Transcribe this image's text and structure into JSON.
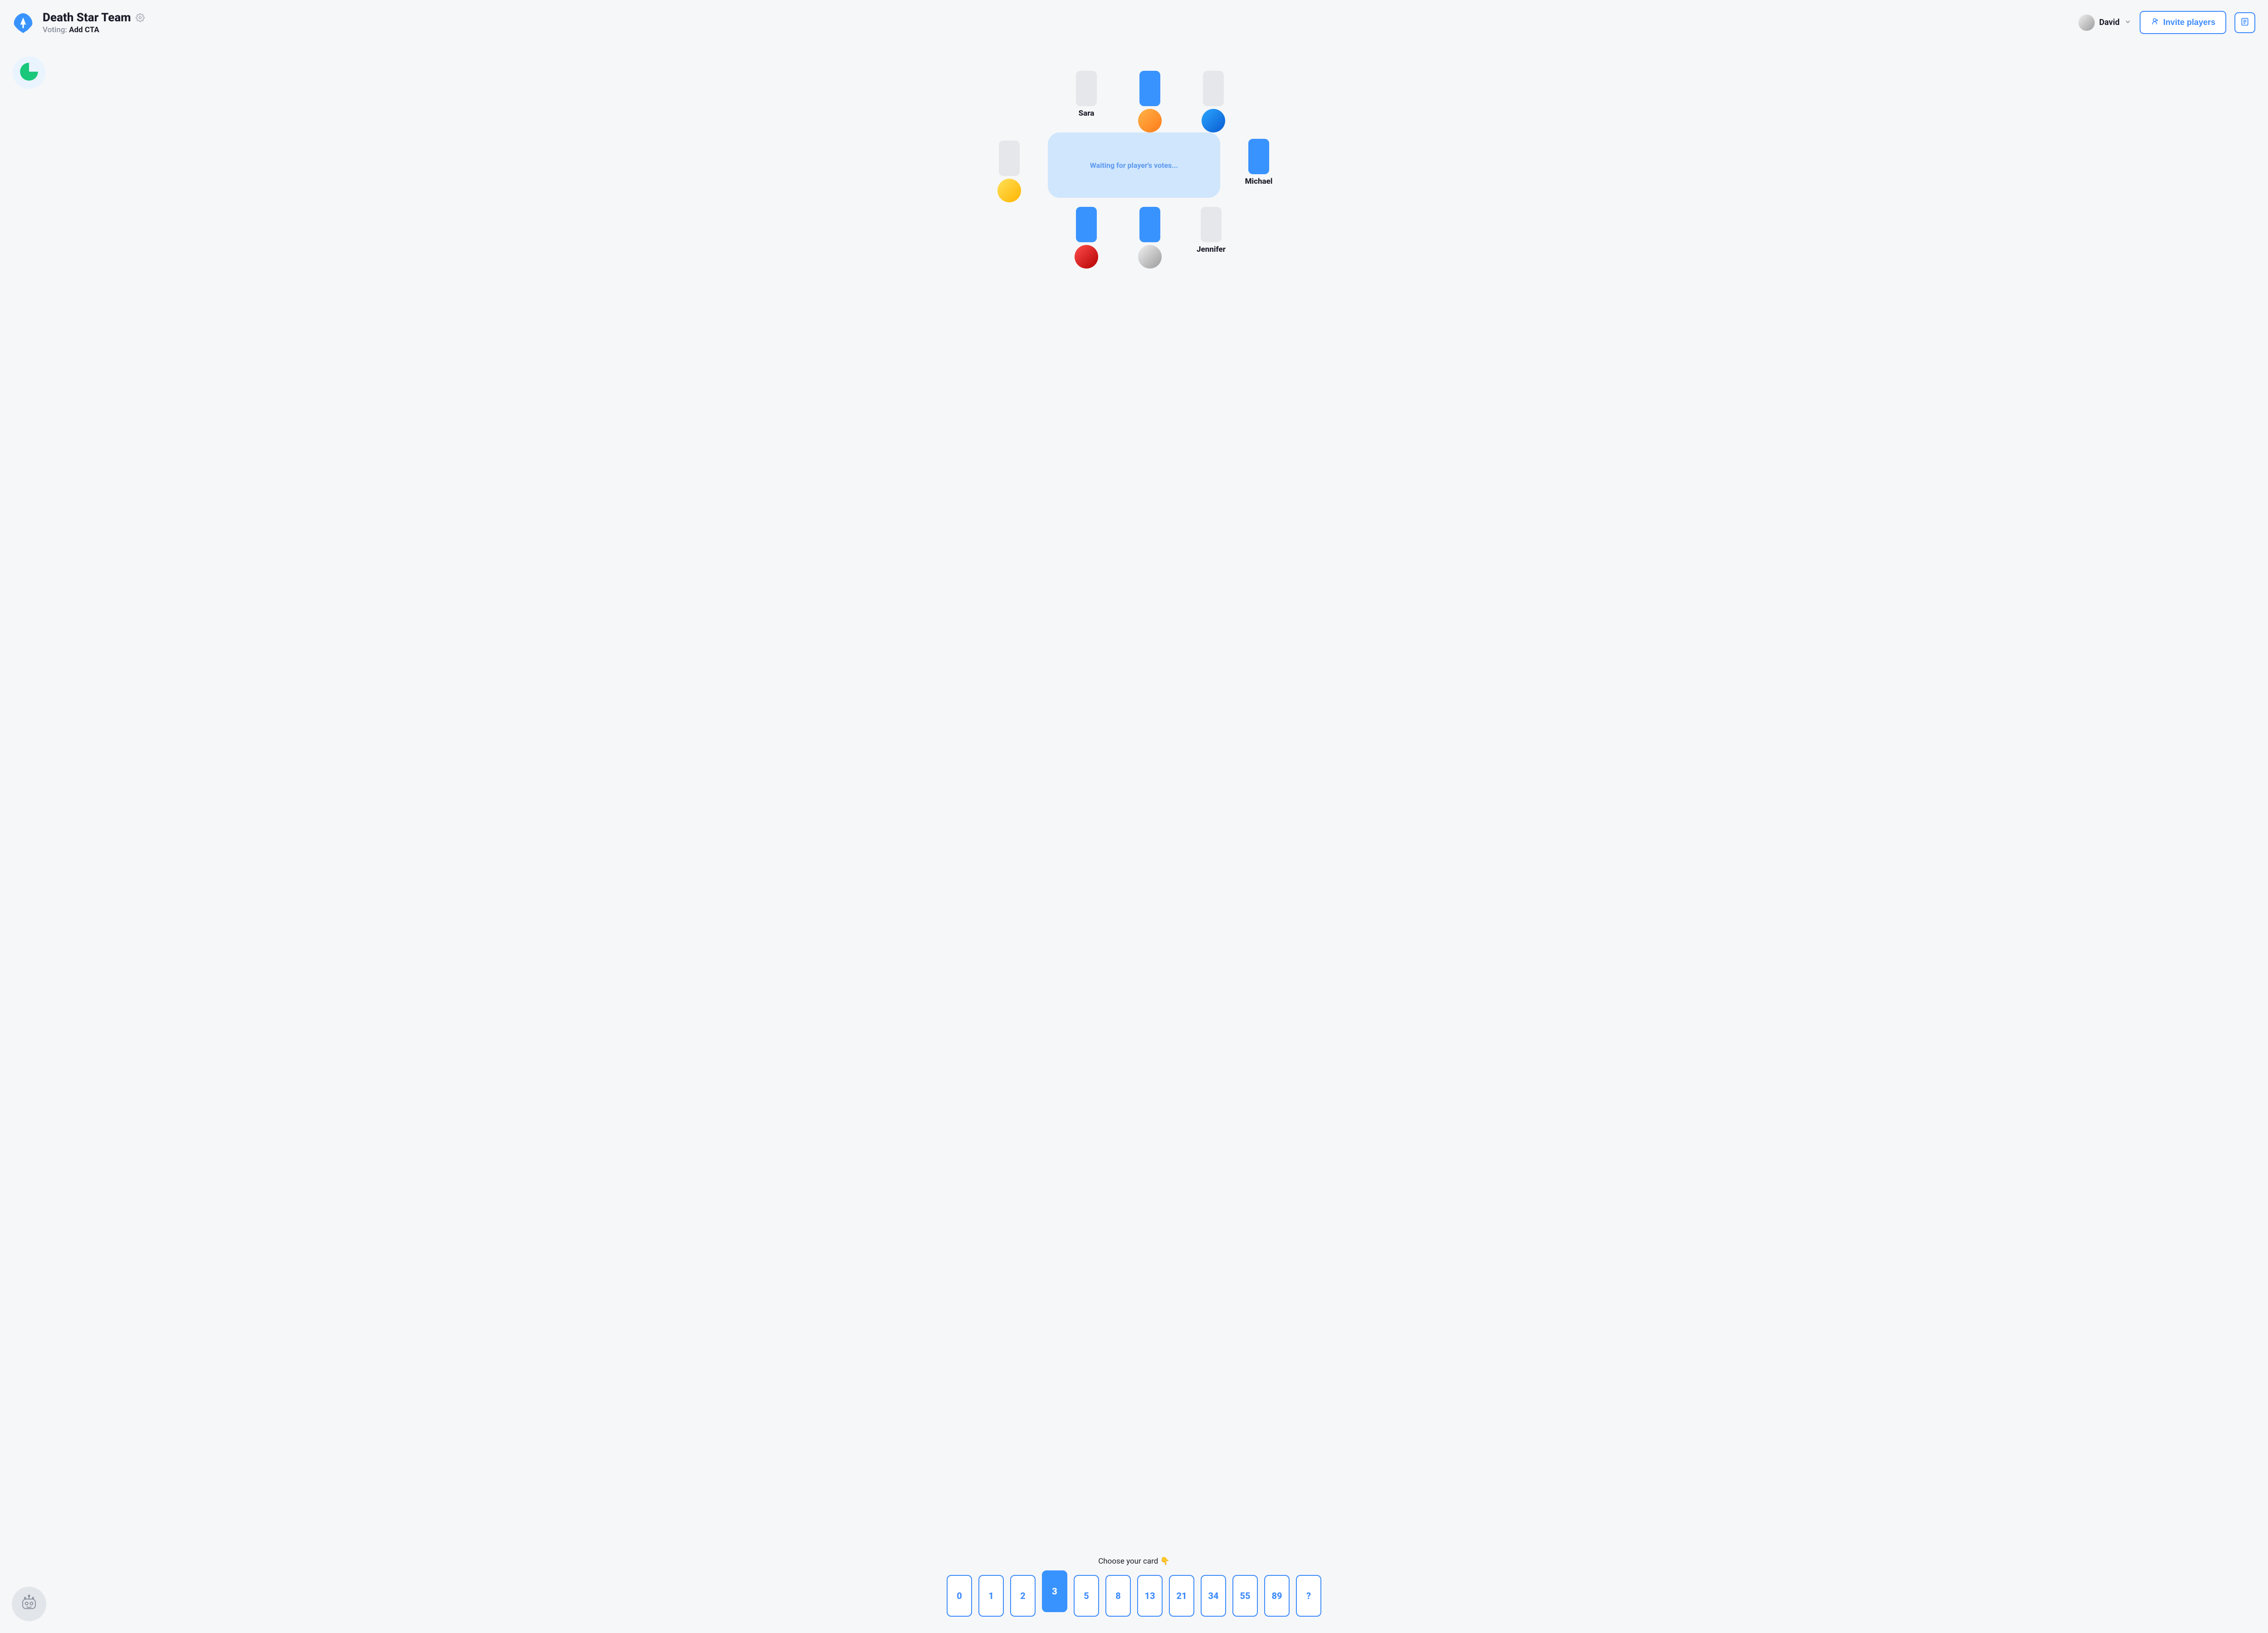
{
  "header": {
    "team_name": "Death Star Team",
    "voting_label": "Voting:",
    "voting_item": "Add CTA",
    "user_name": "David",
    "invite_label": "Invite players"
  },
  "table": {
    "status_text": "Waiting for player's votes..."
  },
  "seats": {
    "top1": {
      "name": "Sara",
      "voted": false,
      "show_avatar": false
    },
    "top2": {
      "name": "",
      "voted": true,
      "show_avatar": true,
      "avatar_class": "av-a"
    },
    "top3": {
      "name": "",
      "voted": false,
      "show_avatar": true,
      "avatar_class": "av-b"
    },
    "left1": {
      "name": "",
      "voted": false,
      "show_avatar": true,
      "avatar_class": "av-c"
    },
    "right1": {
      "name": "Michael",
      "voted": true,
      "show_avatar": false
    },
    "bot1": {
      "name": "",
      "voted": true,
      "show_avatar": true,
      "avatar_class": "av-d"
    },
    "bot2": {
      "name": "",
      "voted": true,
      "show_avatar": true,
      "avatar_class": "av-e"
    },
    "bot3": {
      "name": "Jennifer",
      "voted": false,
      "show_avatar": false
    }
  },
  "deck": {
    "caption": "Choose your card 👇",
    "cards": [
      "0",
      "1",
      "2",
      "3",
      "5",
      "8",
      "13",
      "21",
      "34",
      "55",
      "89",
      "?"
    ],
    "selected_index": 3
  }
}
